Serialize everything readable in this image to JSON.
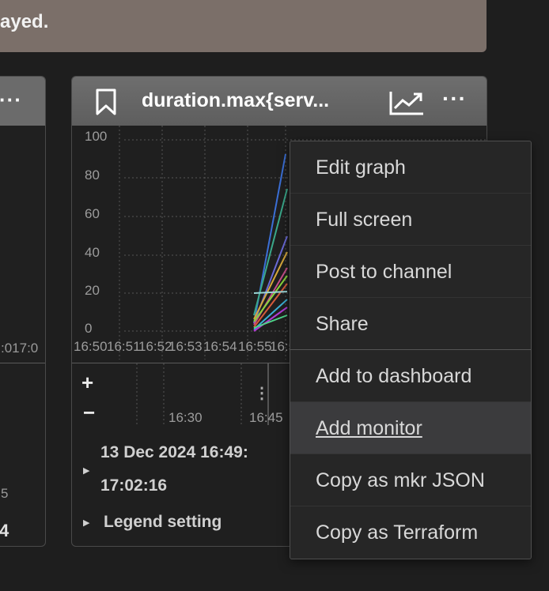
{
  "banner": {
    "text": "ayed."
  },
  "left_panel": {
    "more": "···",
    "ticks": ":017:0",
    "small_text": "5",
    "bold_text": "4"
  },
  "panel": {
    "title": "duration.max{serv...",
    "more": "···",
    "y_labels": [
      "100",
      "80",
      "60",
      "40",
      "20",
      "0"
    ],
    "x_ticks": [
      "16:50",
      "16:51",
      "16:52",
      "16:53",
      "16:54",
      "16:55",
      "16:5"
    ],
    "zoom_in": "+",
    "zoom_out": "−",
    "nav_times": [
      "16:30",
      "16:45"
    ],
    "range_start": "13 Dec 2024 16:49:",
    "range_end": "17:02:16",
    "legend_setting": "Legend setting"
  },
  "menu": {
    "items": [
      "Edit graph",
      "Full screen",
      "Post to channel",
      "Share",
      "Add to dashboard",
      "Add monitor",
      "Copy as mkr JSON",
      "Copy as Terraform"
    ],
    "active_index": 5
  },
  "colors": {
    "banner": "#7b6f69",
    "panel_head": "#6e6e6e",
    "menu_bg": "#262626",
    "menu_active": "#3b3b3d"
  }
}
